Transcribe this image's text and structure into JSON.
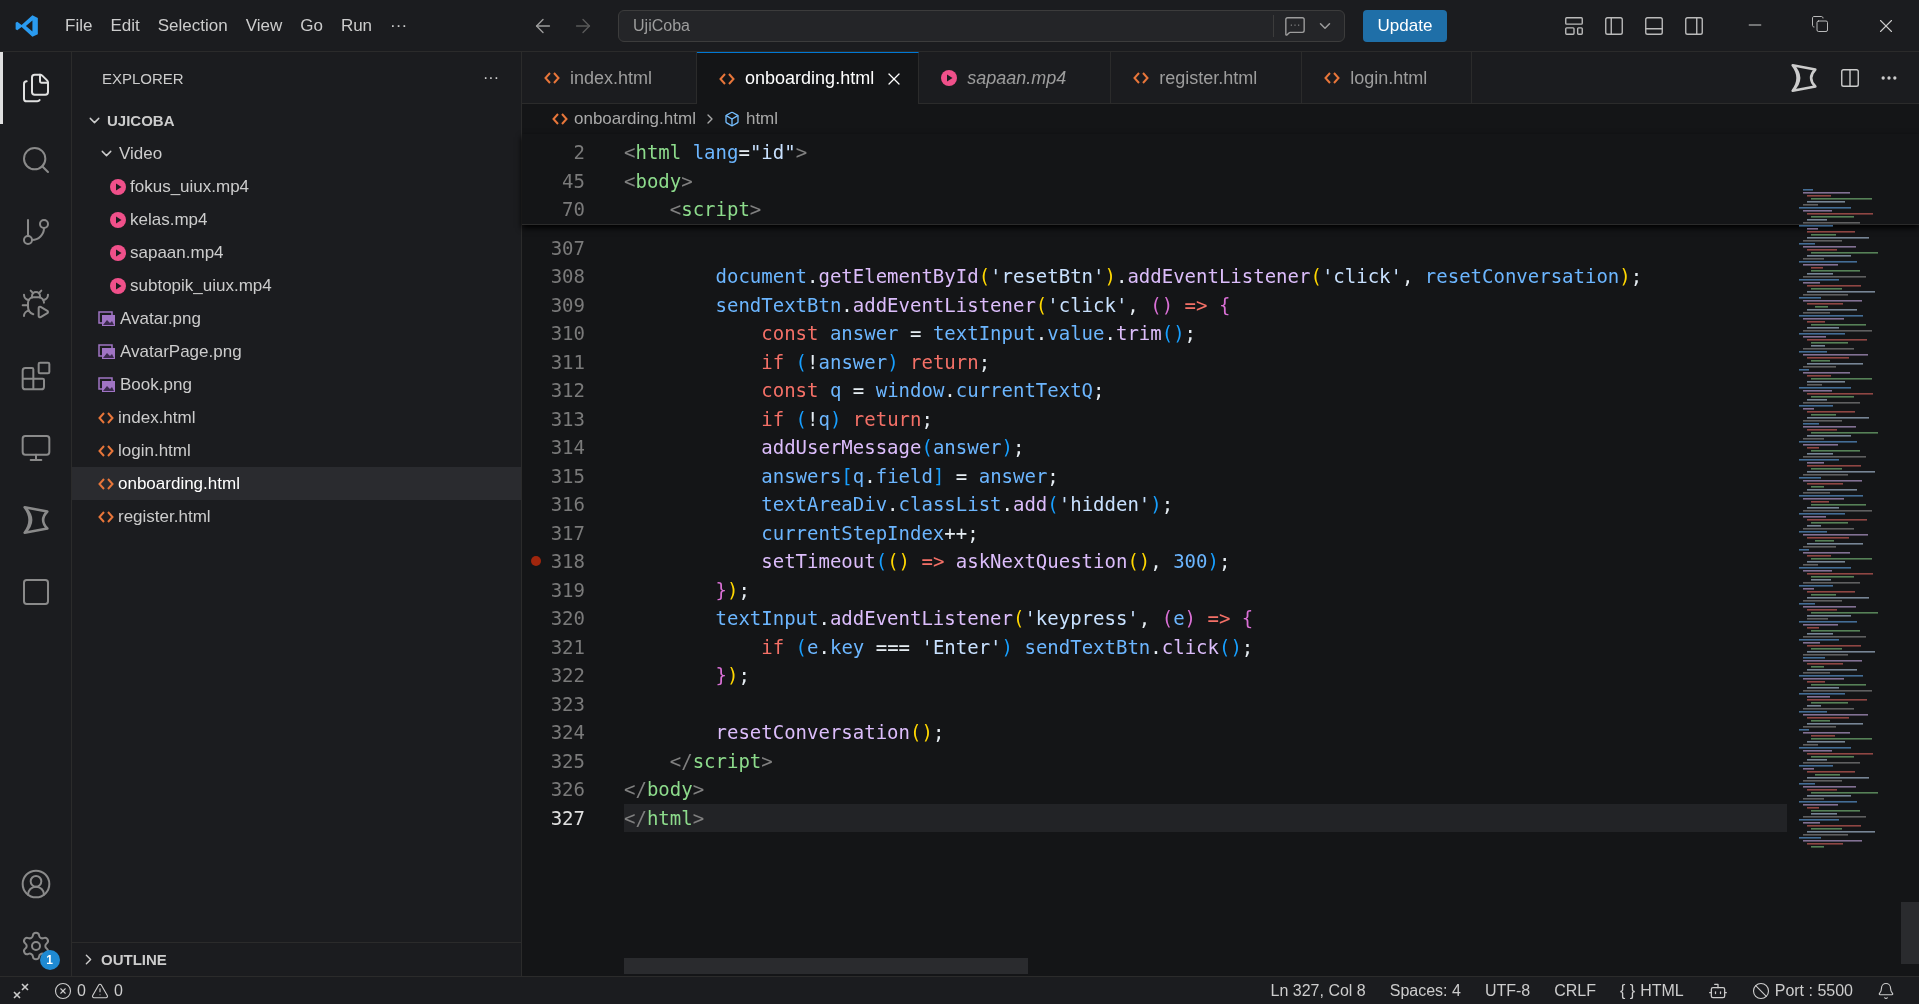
{
  "title_bar": {
    "menu": [
      "File",
      "Edit",
      "Selection",
      "View",
      "Go",
      "Run",
      "···"
    ],
    "command_center": "UjiCoba",
    "update_button": "Update"
  },
  "activity_bar": {
    "items": [
      {
        "kind": "files",
        "selected": true
      },
      {
        "kind": "search",
        "selected": false
      },
      {
        "kind": "source-control",
        "selected": false
      },
      {
        "kind": "run-debug",
        "selected": false
      },
      {
        "kind": "extensions",
        "selected": false
      },
      {
        "kind": "remote",
        "selected": false
      },
      {
        "kind": "bowtie",
        "selected": false
      },
      {
        "kind": "square",
        "selected": false
      }
    ],
    "settings_badge": "1"
  },
  "sidebar": {
    "title": "EXPLORER",
    "more": "···",
    "tree": [
      {
        "label": "UJICOBA",
        "kind": "root",
        "expanded": true,
        "selected": false,
        "children": [
          {
            "label": "Video",
            "kind": "folder",
            "expanded": true,
            "selected": false,
            "children": [
              {
                "label": "fokus_uiux.mp4",
                "kind": "video",
                "selected": false
              },
              {
                "label": "kelas.mp4",
                "kind": "video",
                "selected": false
              },
              {
                "label": "sapaan.mp4",
                "kind": "video",
                "selected": false
              },
              {
                "label": "subtopik_uiux.mp4",
                "kind": "video",
                "selected": false
              }
            ]
          },
          {
            "label": "Avatar.png",
            "kind": "image",
            "selected": false
          },
          {
            "label": "AvatarPage.png",
            "kind": "image",
            "selected": false
          },
          {
            "label": "Book.png",
            "kind": "image",
            "selected": false
          },
          {
            "label": "index.html",
            "kind": "html",
            "selected": false
          },
          {
            "label": "login.html",
            "kind": "html",
            "selected": false
          },
          {
            "label": "onboarding.html",
            "kind": "html",
            "selected": true
          },
          {
            "label": "register.html",
            "kind": "html",
            "selected": false
          }
        ]
      }
    ],
    "outline": {
      "label": "OUTLINE",
      "expanded": false
    }
  },
  "tabs": [
    {
      "label": "index.html",
      "kind": "html",
      "selected": false,
      "preview": false
    },
    {
      "label": "onboarding.html",
      "kind": "html",
      "selected": true,
      "preview": false
    },
    {
      "label": "sapaan.mp4",
      "kind": "video",
      "selected": false,
      "preview": true
    },
    {
      "label": "register.html",
      "kind": "html",
      "selected": false,
      "preview": false
    },
    {
      "label": "login.html",
      "kind": "html",
      "selected": false,
      "preview": false
    }
  ],
  "breadcrumbs": [
    {
      "label": "onboarding.html",
      "kind": "html"
    },
    {
      "label": "html",
      "kind": "element"
    }
  ],
  "sticky_lines": [
    {
      "number": "2",
      "tokens": [
        {
          "kind": "ang",
          "text": "<"
        },
        {
          "kind": "tag",
          "text": "html"
        },
        {
          "kind": "attr",
          "text": " lang"
        },
        {
          "kind": "p",
          "text": "="
        },
        {
          "kind": "str",
          "text": "\"id\""
        },
        {
          "kind": "ang",
          "text": ">"
        }
      ]
    },
    {
      "number": "45",
      "tokens": [
        {
          "kind": "ang",
          "text": "<"
        },
        {
          "kind": "tag",
          "text": "body"
        },
        {
          "kind": "ang",
          "text": ">"
        }
      ]
    },
    {
      "number": "70",
      "tokens": [
        {
          "kind": "ang",
          "text": "    <"
        },
        {
          "kind": "tag",
          "text": "script"
        },
        {
          "kind": "ang",
          "text": ">"
        }
      ]
    }
  ],
  "lines": [
    {
      "number": "307",
      "current": false,
      "breakpoint": false
    },
    {
      "number": "308",
      "current": false,
      "breakpoint": false,
      "tokens": [
        {
          "kind": "var",
          "text": "        document"
        },
        {
          "kind": "p",
          "text": "."
        },
        {
          "kind": "fn",
          "text": "getElementById"
        },
        {
          "kind": "b1",
          "text": "("
        },
        {
          "kind": "str",
          "text": "'resetBtn'"
        },
        {
          "kind": "b1",
          "text": ")"
        },
        {
          "kind": "p",
          "text": "."
        },
        {
          "kind": "fn",
          "text": "addEventListener"
        },
        {
          "kind": "b1",
          "text": "("
        },
        {
          "kind": "str",
          "text": "'click'"
        },
        {
          "kind": "p",
          "text": ", "
        },
        {
          "kind": "var",
          "text": "resetConversation"
        },
        {
          "kind": "b1",
          "text": ")"
        },
        {
          "kind": "p",
          "text": ";"
        }
      ]
    },
    {
      "number": "309",
      "current": false,
      "breakpoint": false,
      "tokens": [
        {
          "kind": "var",
          "text": "        sendTextBtn"
        },
        {
          "kind": "p",
          "text": "."
        },
        {
          "kind": "fn",
          "text": "addEventListener"
        },
        {
          "kind": "b1",
          "text": "("
        },
        {
          "kind": "str",
          "text": "'click'"
        },
        {
          "kind": "p",
          "text": ", "
        },
        {
          "kind": "b2",
          "text": "()"
        },
        {
          "kind": "kw",
          "text": " => "
        },
        {
          "kind": "b2",
          "text": "{"
        }
      ]
    },
    {
      "number": "310",
      "current": false,
      "breakpoint": false,
      "tokens": [
        {
          "kind": "kw",
          "text": "            const"
        },
        {
          "kind": "var",
          "text": " answer"
        },
        {
          "kind": "p",
          "text": " = "
        },
        {
          "kind": "var",
          "text": "textInput"
        },
        {
          "kind": "p",
          "text": "."
        },
        {
          "kind": "var",
          "text": "value"
        },
        {
          "kind": "p",
          "text": "."
        },
        {
          "kind": "fn",
          "text": "trim"
        },
        {
          "kind": "b3",
          "text": "()"
        },
        {
          "kind": "p",
          "text": ";"
        }
      ]
    },
    {
      "number": "311",
      "current": false,
      "breakpoint": false,
      "tokens": [
        {
          "kind": "kw",
          "text": "            if"
        },
        {
          "kind": "b3",
          "text": " ("
        },
        {
          "kind": "p",
          "text": "!"
        },
        {
          "kind": "var",
          "text": "answer"
        },
        {
          "kind": "b3",
          "text": ")"
        },
        {
          "kind": "kw",
          "text": " return"
        },
        {
          "kind": "p",
          "text": ";"
        }
      ]
    },
    {
      "number": "312",
      "current": false,
      "breakpoint": false,
      "tokens": [
        {
          "kind": "kw",
          "text": "            const"
        },
        {
          "kind": "var",
          "text": " q"
        },
        {
          "kind": "p",
          "text": " = "
        },
        {
          "kind": "var",
          "text": "window"
        },
        {
          "kind": "p",
          "text": "."
        },
        {
          "kind": "var",
          "text": "currentTextQ"
        },
        {
          "kind": "p",
          "text": ";"
        }
      ]
    },
    {
      "number": "313",
      "current": false,
      "breakpoint": false,
      "tokens": [
        {
          "kind": "kw",
          "text": "            if"
        },
        {
          "kind": "b3",
          "text": " ("
        },
        {
          "kind": "p",
          "text": "!"
        },
        {
          "kind": "var",
          "text": "q"
        },
        {
          "kind": "b3",
          "text": ")"
        },
        {
          "kind": "kw",
          "text": " return"
        },
        {
          "kind": "p",
          "text": ";"
        }
      ]
    },
    {
      "number": "314",
      "current": false,
      "breakpoint": false,
      "tokens": [
        {
          "kind": "fn",
          "text": "            addUserMessage"
        },
        {
          "kind": "b3",
          "text": "("
        },
        {
          "kind": "var",
          "text": "answer"
        },
        {
          "kind": "b3",
          "text": ")"
        },
        {
          "kind": "p",
          "text": ";"
        }
      ]
    },
    {
      "number": "315",
      "current": false,
      "breakpoint": false,
      "tokens": [
        {
          "kind": "var",
          "text": "            answers"
        },
        {
          "kind": "b3",
          "text": "["
        },
        {
          "kind": "var",
          "text": "q"
        },
        {
          "kind": "p",
          "text": "."
        },
        {
          "kind": "var",
          "text": "field"
        },
        {
          "kind": "b3",
          "text": "]"
        },
        {
          "kind": "p",
          "text": " = "
        },
        {
          "kind": "var",
          "text": "answer"
        },
        {
          "kind": "p",
          "text": ";"
        }
      ]
    },
    {
      "number": "316",
      "current": false,
      "breakpoint": false,
      "tokens": [
        {
          "kind": "var",
          "text": "            textAreaDiv"
        },
        {
          "kind": "p",
          "text": "."
        },
        {
          "kind": "var",
          "text": "classList"
        },
        {
          "kind": "p",
          "text": "."
        },
        {
          "kind": "fn",
          "text": "add"
        },
        {
          "kind": "b3",
          "text": "("
        },
        {
          "kind": "str",
          "text": "'hidden'"
        },
        {
          "kind": "b3",
          "text": ")"
        },
        {
          "kind": "p",
          "text": ";"
        }
      ]
    },
    {
      "number": "317",
      "current": false,
      "breakpoint": false,
      "tokens": [
        {
          "kind": "var",
          "text": "            currentStepIndex"
        },
        {
          "kind": "p",
          "text": "++;"
        }
      ]
    },
    {
      "number": "318",
      "current": false,
      "breakpoint": true,
      "tokens": [
        {
          "kind": "fn",
          "text": "            setTimeout"
        },
        {
          "kind": "b3",
          "text": "("
        },
        {
          "kind": "b1",
          "text": "()"
        },
        {
          "kind": "kw",
          "text": " => "
        },
        {
          "kind": "fn",
          "text": "askNextQuestion"
        },
        {
          "kind": "b1",
          "text": "()"
        },
        {
          "kind": "p",
          "text": ", "
        },
        {
          "kind": "num",
          "text": "300"
        },
        {
          "kind": "b3",
          "text": ")"
        },
        {
          "kind": "p",
          "text": ";"
        }
      ]
    },
    {
      "number": "319",
      "current": false,
      "breakpoint": false,
      "tokens": [
        {
          "kind": "b2",
          "text": "        }"
        },
        {
          "kind": "b1",
          "text": ")"
        },
        {
          "kind": "p",
          "text": ";"
        }
      ]
    },
    {
      "number": "320",
      "current": false,
      "breakpoint": false,
      "tokens": [
        {
          "kind": "var",
          "text": "        textInput"
        },
        {
          "kind": "p",
          "text": "."
        },
        {
          "kind": "fn",
          "text": "addEventListener"
        },
        {
          "kind": "b1",
          "text": "("
        },
        {
          "kind": "str",
          "text": "'keypress'"
        },
        {
          "kind": "p",
          "text": ", "
        },
        {
          "kind": "b2",
          "text": "("
        },
        {
          "kind": "var",
          "text": "e"
        },
        {
          "kind": "b2",
          "text": ")"
        },
        {
          "kind": "kw",
          "text": " => "
        },
        {
          "kind": "b2",
          "text": "{"
        }
      ]
    },
    {
      "number": "321",
      "current": false,
      "breakpoint": false,
      "tokens": [
        {
          "kind": "kw",
          "text": "            if"
        },
        {
          "kind": "b3",
          "text": " ("
        },
        {
          "kind": "var",
          "text": "e"
        },
        {
          "kind": "p",
          "text": "."
        },
        {
          "kind": "var",
          "text": "key"
        },
        {
          "kind": "p",
          "text": " === "
        },
        {
          "kind": "str",
          "text": "'Enter'"
        },
        {
          "kind": "b3",
          "text": ")"
        },
        {
          "kind": "var",
          "text": " sendTextBtn"
        },
        {
          "kind": "p",
          "text": "."
        },
        {
          "kind": "fn",
          "text": "click"
        },
        {
          "kind": "b3",
          "text": "()"
        },
        {
          "kind": "p",
          "text": ";"
        }
      ]
    },
    {
      "number": "322",
      "current": false,
      "breakpoint": false,
      "tokens": [
        {
          "kind": "b2",
          "text": "        }"
        },
        {
          "kind": "b1",
          "text": ")"
        },
        {
          "kind": "p",
          "text": ";"
        }
      ]
    },
    {
      "number": "323",
      "current": false,
      "breakpoint": false
    },
    {
      "number": "324",
      "current": false,
      "breakpoint": false,
      "tokens": [
        {
          "kind": "fn",
          "text": "        resetConversation"
        },
        {
          "kind": "b1",
          "text": "()"
        },
        {
          "kind": "p",
          "text": ";"
        }
      ]
    },
    {
      "number": "325",
      "current": false,
      "breakpoint": false,
      "tokens": [
        {
          "kind": "ang",
          "text": "    </"
        },
        {
          "kind": "tag",
          "text": "script"
        },
        {
          "kind": "ang",
          "text": ">"
        }
      ]
    },
    {
      "number": "326",
      "current": false,
      "breakpoint": false,
      "tokens": [
        {
          "kind": "ang",
          "text": "</"
        },
        {
          "kind": "tag",
          "text": "body"
        },
        {
          "kind": "ang",
          "text": ">"
        }
      ]
    },
    {
      "number": "327",
      "current": true,
      "breakpoint": false,
      "tokens": [
        {
          "kind": "ang",
          "text": "</"
        },
        {
          "kind": "tag",
          "text": "html"
        },
        {
          "kind": "ang",
          "text": ">"
        }
      ]
    }
  ],
  "status_bar": {
    "errors": "0",
    "warnings": "0",
    "position": "Ln 327, Col 8",
    "indent": "Spaces: 4",
    "encoding": "UTF-8",
    "eol": "CRLF",
    "language_glyph": "{ }",
    "language": "HTML",
    "port": "Port : 5500"
  }
}
